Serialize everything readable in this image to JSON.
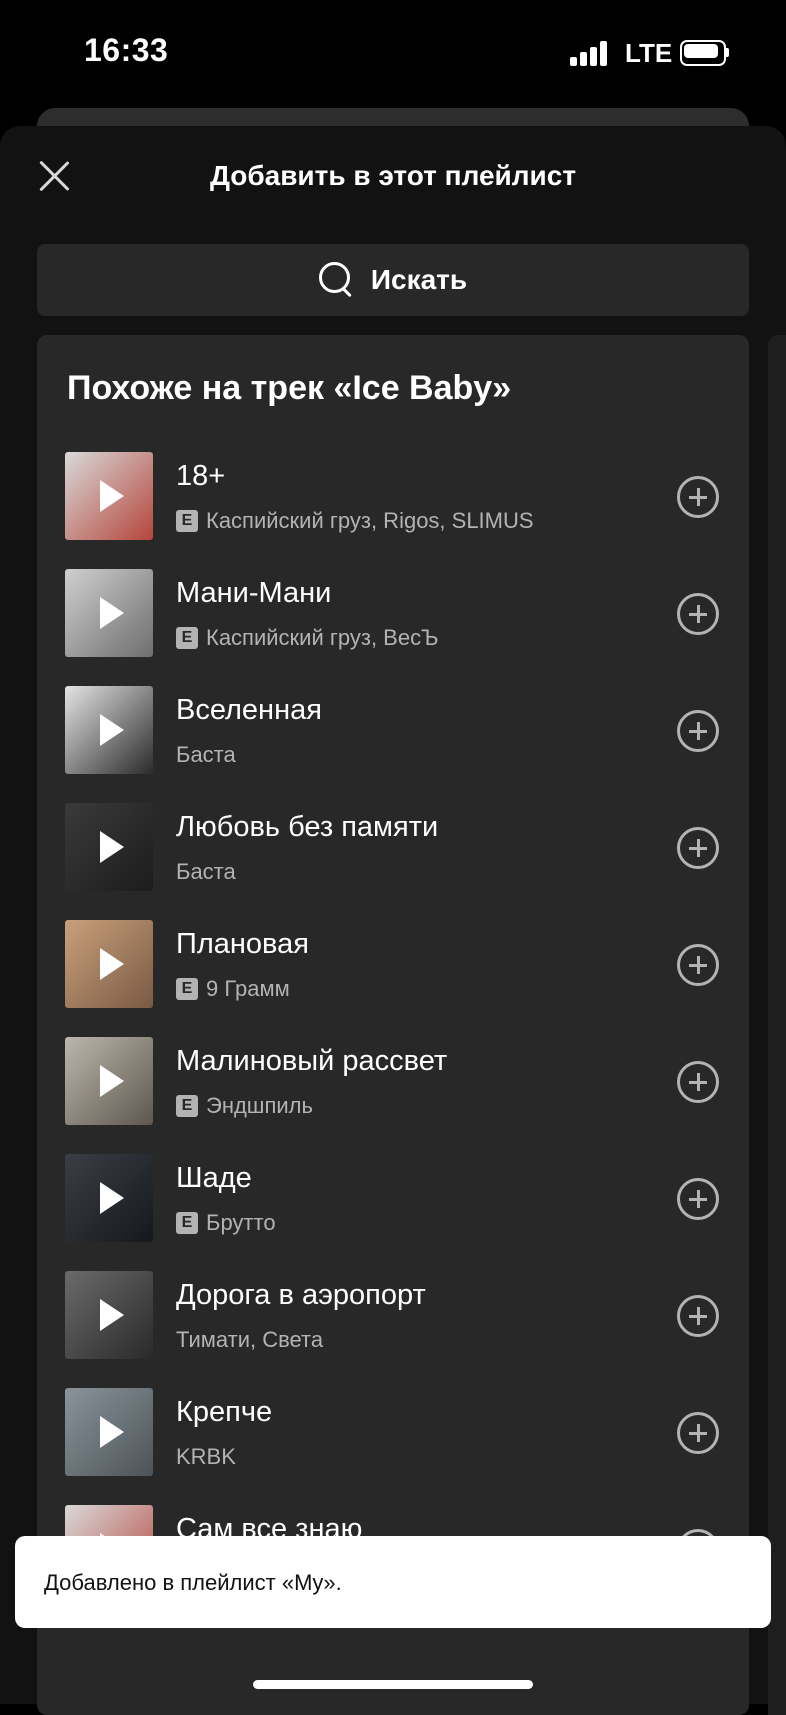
{
  "status": {
    "time": "16:33",
    "network": "LTE"
  },
  "sheet": {
    "title": "Добавить в этот плейлист"
  },
  "search": {
    "label": "Искать"
  },
  "section": {
    "title": "Похоже на трек «Ice Baby»",
    "tracks": [
      {
        "title": "18+",
        "artists": "Каспийский груз, Rigos, SLIMUS",
        "explicit": true,
        "cover": [
          "#d9d9d9",
          "#b5463c"
        ]
      },
      {
        "title": "Мани-Мани",
        "artists": "Каспийский груз, ВесЪ",
        "explicit": true,
        "cover": [
          "#cfcfcf",
          "#6e6e6e"
        ]
      },
      {
        "title": "Вселенная",
        "artists": "Баста",
        "explicit": false,
        "cover": [
          "#e4e4e4",
          "#2b2b2b"
        ]
      },
      {
        "title": "Любовь без памяти",
        "artists": "Баста",
        "explicit": false,
        "cover": [
          "#3a3a3a",
          "#1c1c1c"
        ]
      },
      {
        "title": "Плановая",
        "artists": "9 Грамм",
        "explicit": true,
        "cover": [
          "#c9a07a",
          "#7a5a44"
        ]
      },
      {
        "title": "Малиновый рассвет",
        "artists": "Эндшпиль",
        "explicit": true,
        "cover": [
          "#bdb6ac",
          "#5d574f"
        ]
      },
      {
        "title": "Шаде",
        "artists": "Брутто",
        "explicit": true,
        "cover": [
          "#3b3f45",
          "#15181c"
        ]
      },
      {
        "title": "Дорога в аэропорт",
        "artists": "Тимати, Света",
        "explicit": false,
        "cover": [
          "#6a6a6a",
          "#2a2a2a"
        ]
      },
      {
        "title": "Крепче",
        "artists": "KRBK",
        "explicit": false,
        "cover": [
          "#8a949a",
          "#4c5358"
        ]
      },
      {
        "title": "Сам все знаю",
        "artists": "",
        "explicit": false,
        "cover": [
          "#d9d9d9",
          "#b5463c"
        ]
      }
    ]
  },
  "toast": {
    "text": "Добавлено в плейлист «My»."
  },
  "explicit_badge": "E",
  "icons": {
    "close": "close-icon",
    "search": "search-icon",
    "play": "play-icon",
    "add": "add-circle-icon",
    "signal": "signal-icon",
    "battery": "battery-icon"
  },
  "colors": {
    "background": "#121212",
    "card": "#282828",
    "secondary_text": "#b3b3b3",
    "toast_bg": "#ffffff"
  }
}
